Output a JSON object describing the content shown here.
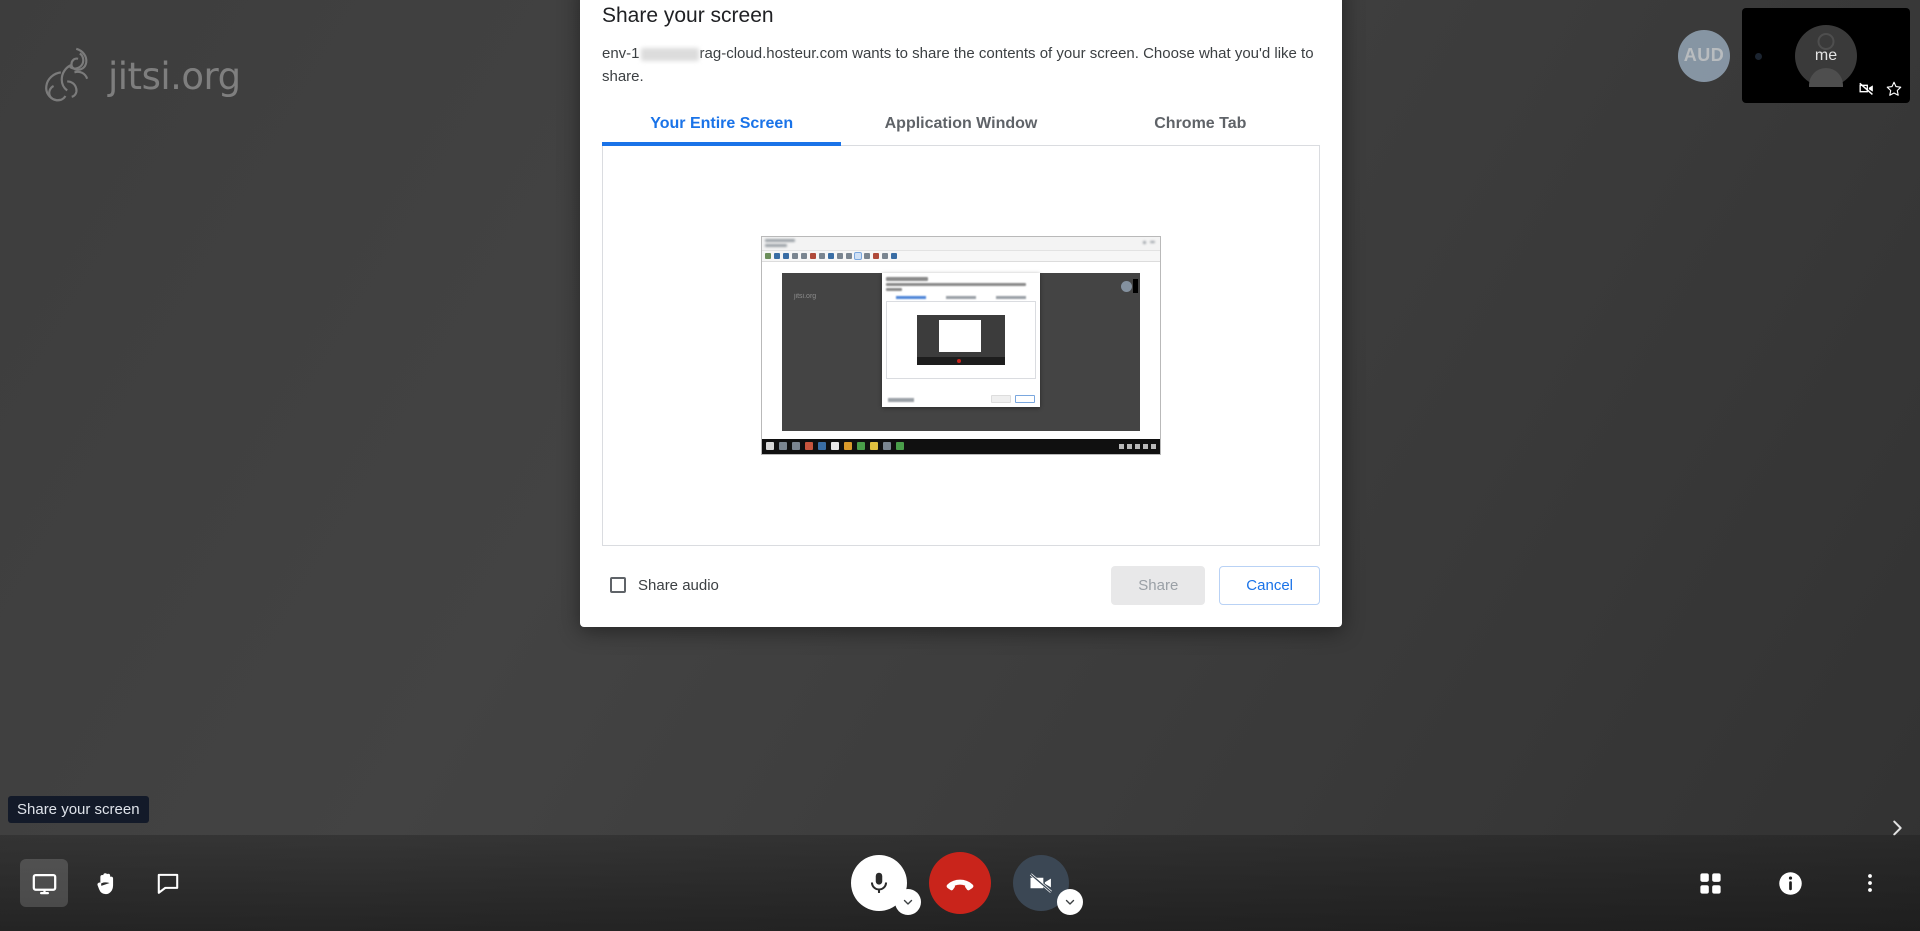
{
  "app": {
    "watermark_text": "jitsi.org",
    "watermark_icon": "jitsi-logo-icon"
  },
  "filmstrip": {
    "audio_avatar_initials": "AUD",
    "self_thumbnail": {
      "label": "me",
      "camera_off_icon": "camera-disabled-icon",
      "pin_icon": "star-icon"
    }
  },
  "toolbar": {
    "tooltip": "Share your screen",
    "left": [
      {
        "name": "share-screen",
        "icon": "screen-share-icon",
        "active": true
      },
      {
        "name": "raise-hand",
        "icon": "raised-hand-icon",
        "active": false
      },
      {
        "name": "chat",
        "icon": "chat-bubble-icon",
        "active": false
      }
    ],
    "center": [
      {
        "name": "microphone",
        "icon": "microphone-icon",
        "menu_icon": "chevron-down-icon"
      },
      {
        "name": "hangup",
        "icon": "phone-hangup-icon"
      },
      {
        "name": "camera",
        "icon": "camera-disabled-icon",
        "menu_icon": "chevron-down-icon"
      }
    ],
    "right": [
      {
        "name": "tile-view",
        "icon": "tile-view-icon"
      },
      {
        "name": "info",
        "icon": "info-circle-icon"
      },
      {
        "name": "more-options",
        "icon": "more-vertical-icon"
      }
    ],
    "filmstrip_toggle_icon": "chevron-right-icon"
  },
  "dialog": {
    "title": "Share your screen",
    "description_before": "env-1",
    "description_after": "rag-cloud.hosteur.com wants to share the contents of your screen. Choose what you'd like to share.",
    "tabs": [
      {
        "label": "Your Entire Screen",
        "active": true
      },
      {
        "label": "Application Window",
        "active": false
      },
      {
        "label": "Chrome Tab",
        "active": false
      }
    ],
    "share_audio_label": "Share audio",
    "share_audio_checked": false,
    "share_button": "Share",
    "share_button_disabled": true,
    "cancel_button": "Cancel"
  },
  "colors": {
    "accent_blue": "#1a73e8",
    "hangup_red": "#c9241b",
    "background_dark": "#3d3d3d"
  }
}
